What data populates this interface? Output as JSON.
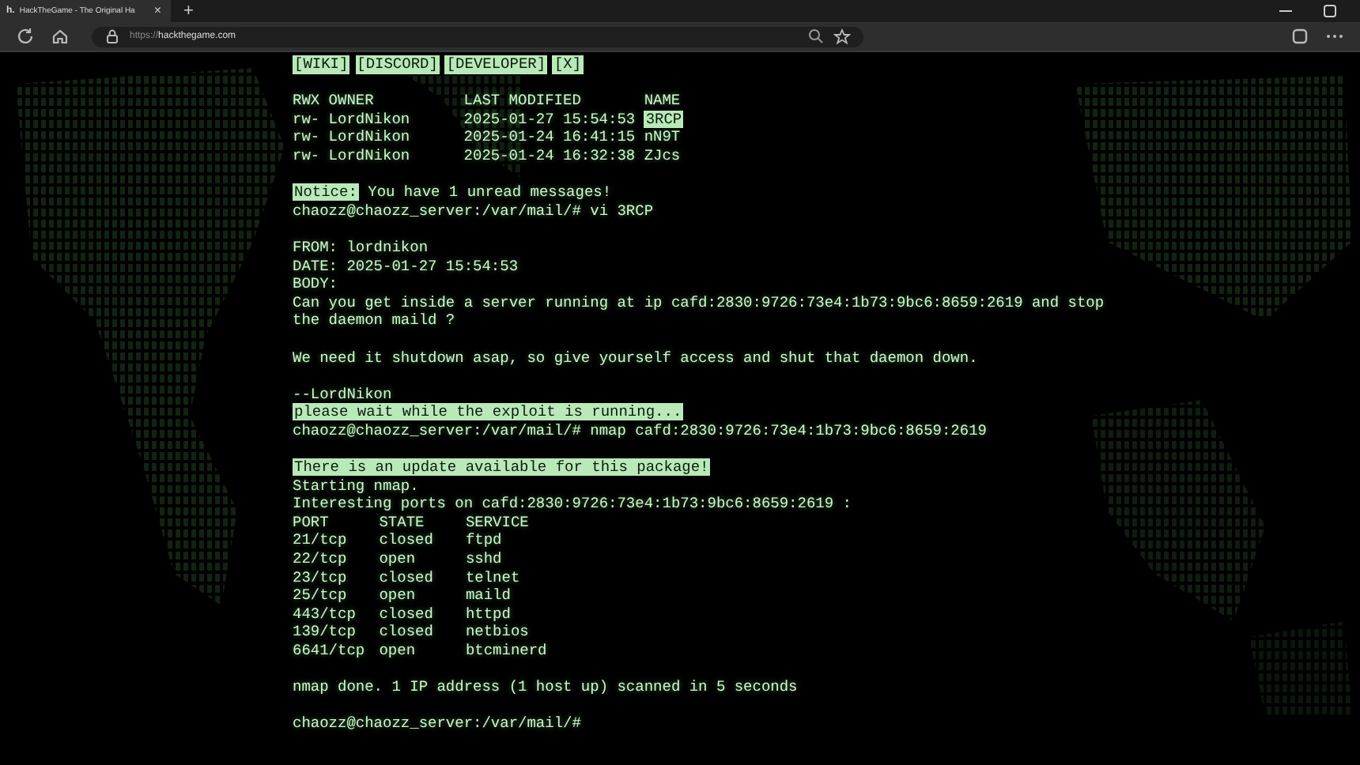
{
  "browser": {
    "tab": {
      "favicon": "h.",
      "title": "HackTheGame - The Original Ha",
      "close": "×",
      "selected": true
    },
    "new_tab": "+",
    "url_scheme": "https://",
    "url_host": "hackthegame.com"
  },
  "terminal": {
    "blocks": [
      {
        "kind": "links",
        "items": [
          "[WIKI]",
          "[DISCORD]",
          "[DEVELOPER]",
          "[X]"
        ]
      },
      {
        "kind": "blank"
      },
      {
        "kind": "listing",
        "columns": [
          "RWX",
          "OWNER",
          "LAST MODIFIED",
          "NAME"
        ],
        "rows": [
          {
            "rwx": "rw-",
            "owner": "LordNikon",
            "modified": "2025-01-27 15:54:53",
            "name": "3RCP",
            "highlighted": true
          },
          {
            "rwx": "rw-",
            "owner": "LordNikon",
            "modified": "2025-01-24 16:41:15",
            "name": "nN9T",
            "highlighted": false
          },
          {
            "rwx": "rw-",
            "owner": "LordNikon",
            "modified": "2025-01-24 16:32:38",
            "name": "ZJcs",
            "highlighted": false
          }
        ]
      },
      {
        "kind": "blank"
      },
      {
        "kind": "notice",
        "badge": "Notice:",
        "text": "You have 1 unread messages!"
      },
      {
        "kind": "text",
        "text": "chaozz@chaozz_server:/var/mail/# vi 3RCP"
      },
      {
        "kind": "blank"
      },
      {
        "kind": "text",
        "text": "FROM: lordnikon"
      },
      {
        "kind": "text",
        "text": "DATE: 2025-01-27 15:54:53"
      },
      {
        "kind": "text",
        "text": "BODY:"
      },
      {
        "kind": "text",
        "text": "Can you get inside a server running at ip cafd:2830:9726:73e4:1b73:9bc6:8659:2619 and stop"
      },
      {
        "kind": "text",
        "text": "the daemon maild ?"
      },
      {
        "kind": "blank"
      },
      {
        "kind": "text",
        "text": "We need it shutdown asap, so give yourself access and shut that daemon down."
      },
      {
        "kind": "blank"
      },
      {
        "kind": "text",
        "text": "--LordNikon"
      },
      {
        "kind": "highlight",
        "text": "please wait while the exploit is running..."
      },
      {
        "kind": "text",
        "text": "chaozz@chaozz_server:/var/mail/# nmap cafd:2830:9726:73e4:1b73:9bc6:8659:2619"
      },
      {
        "kind": "blank"
      },
      {
        "kind": "highlight",
        "text": "There is an update available for this package!"
      },
      {
        "kind": "text",
        "text": "Starting nmap."
      },
      {
        "kind": "text",
        "text": "Interesting ports on cafd:2830:9726:73e4:1b73:9bc6:8659:2619 :"
      },
      {
        "kind": "ports",
        "columns": [
          "PORT",
          "STATE",
          "SERVICE"
        ],
        "rows": [
          {
            "port": "21/tcp",
            "state": "closed",
            "service": "ftpd"
          },
          {
            "port": "22/tcp",
            "state": "open",
            "service": "sshd"
          },
          {
            "port": "23/tcp",
            "state": "closed",
            "service": "telnet"
          },
          {
            "port": "25/tcp",
            "state": "open",
            "service": "maild"
          },
          {
            "port": "443/tcp",
            "state": "closed",
            "service": "httpd"
          },
          {
            "port": "139/tcp",
            "state": "closed",
            "service": "netbios"
          },
          {
            "port": "6641/tcp",
            "state": "open",
            "service": "btcminerd"
          }
        ]
      },
      {
        "kind": "blank"
      },
      {
        "kind": "text",
        "text": "nmap done. 1 IP address (1 host up) scanned in 5 seconds"
      },
      {
        "kind": "blank"
      },
      {
        "kind": "text",
        "text": "chaozz@chaozz_server:/var/mail/#"
      }
    ]
  }
}
